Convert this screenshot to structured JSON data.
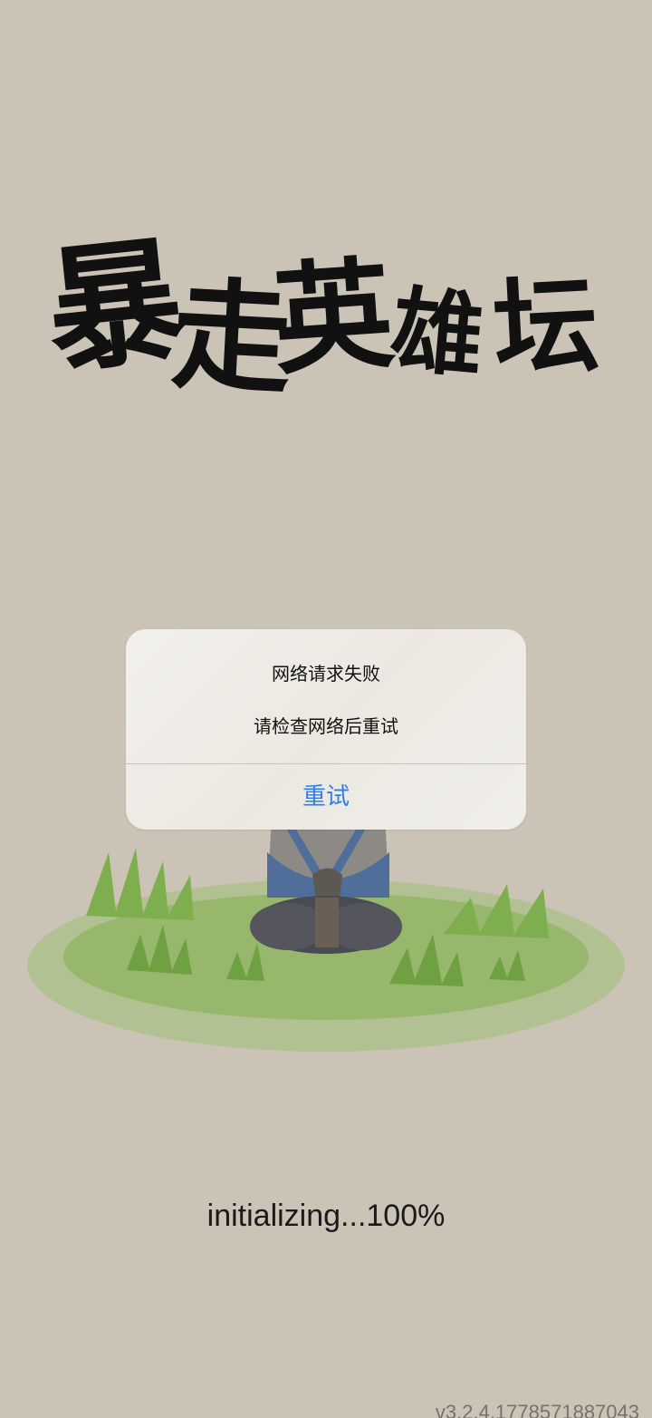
{
  "logo": {
    "text": "暴走英雄坛",
    "chars": [
      "暴",
      "走",
      "英",
      "雄",
      "坛"
    ]
  },
  "dialog": {
    "title": "网络请求失败",
    "message": "请检查网络后重试",
    "retry_label": "重试",
    "retry_color": "#2f7fe8"
  },
  "status": {
    "progress_text": "initializing...100%",
    "version": "v3.2.4.1778571887043"
  },
  "colors": {
    "background": "#cbc4b6",
    "grass": "#7fae4e",
    "robe": "#4f6f9a"
  }
}
